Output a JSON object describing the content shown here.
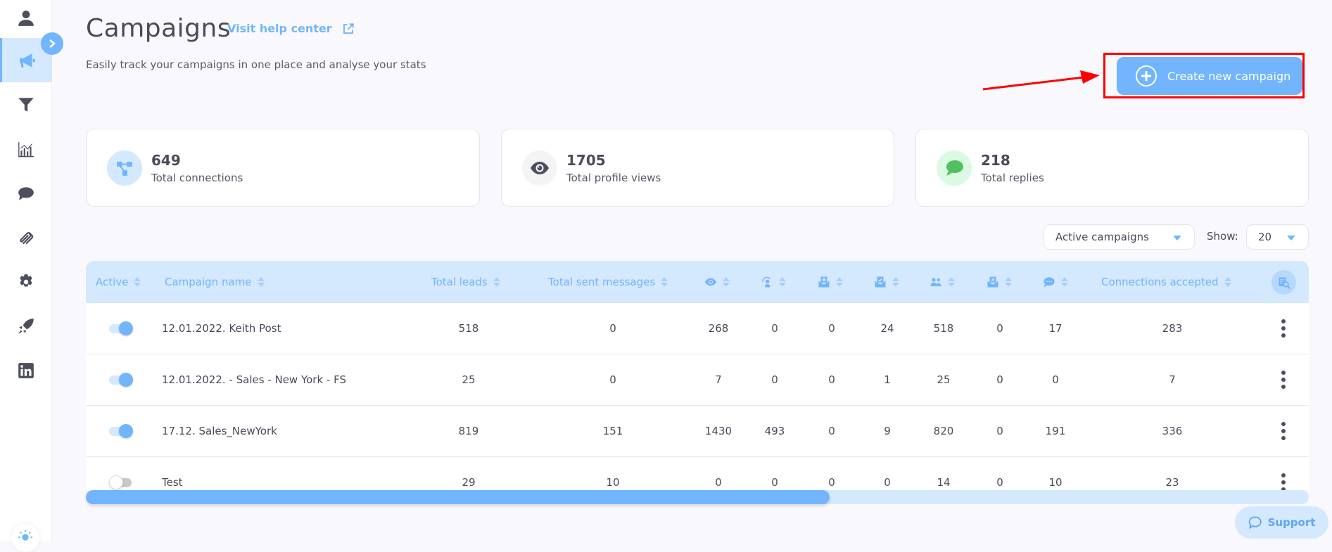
{
  "sidebar": {
    "items": [
      {
        "name": "profile",
        "icon": "user-icon",
        "active": false
      },
      {
        "name": "campaigns",
        "icon": "megaphone-icon",
        "active": true
      },
      {
        "name": "filters",
        "icon": "funnel-icon",
        "active": false
      },
      {
        "name": "analytics",
        "icon": "chart-icon",
        "active": false
      },
      {
        "name": "messages",
        "icon": "chat-bubble-icon",
        "active": false
      },
      {
        "name": "integrations",
        "icon": "paperclip-icon",
        "active": false
      },
      {
        "name": "settings",
        "icon": "gear-icon",
        "active": false
      },
      {
        "name": "launch",
        "icon": "rocket-icon",
        "active": false
      },
      {
        "name": "linkedin",
        "icon": "linkedin-icon",
        "active": false
      }
    ],
    "expand_icon": "chevron-right-icon",
    "theme_icon": "sun-icon"
  },
  "header": {
    "title": "Campaigns",
    "help_link": "Visit help center",
    "subtitle": "Easily track your campaigns in one place and analyse your stats",
    "create_button": "Create new campaign"
  },
  "stats": [
    {
      "value": "649",
      "label": "Total connections",
      "icon": "network-icon",
      "icon_bg": "#d4e8fe",
      "icon_color": "#72b5fd"
    },
    {
      "value": "1705",
      "label": "Total profile views",
      "icon": "eye-icon",
      "icon_bg": "#f4f4f6",
      "icon_color": "#4d4f5c"
    },
    {
      "value": "218",
      "label": "Total replies",
      "icon": "speech-bubble-icon",
      "icon_bg": "#dcfae3",
      "icon_color": "#50c060"
    }
  ],
  "filters": {
    "campaign_filter": "Active campaigns",
    "show_label": "Show:",
    "show_value": "20"
  },
  "table": {
    "columns": [
      {
        "label": "Active"
      },
      {
        "label": "Campaign name"
      },
      {
        "label": "Total leads"
      },
      {
        "label": "Total sent messages"
      },
      {
        "label": "",
        "icon": "eye-icon"
      },
      {
        "label": "",
        "icon": "follow-icon"
      },
      {
        "label": "",
        "icon": "mail-pending-icon"
      },
      {
        "label": "",
        "icon": "mail-accepted-icon"
      },
      {
        "label": "",
        "icon": "people-icon"
      },
      {
        "label": "",
        "icon": "mail-reply-icon"
      },
      {
        "label": "",
        "icon": "chat-icon"
      },
      {
        "label": "Connections accepted"
      }
    ],
    "search_icon": "column-search-icon",
    "rows": [
      {
        "active": true,
        "name": "12.01.2022. Keith Post",
        "values": [
          "518",
          "0",
          "268",
          "0",
          "0",
          "24",
          "518",
          "0",
          "17",
          "283"
        ]
      },
      {
        "active": true,
        "name": "12.01.2022. - Sales - New York - FS",
        "values": [
          "25",
          "0",
          "7",
          "0",
          "0",
          "1",
          "25",
          "0",
          "0",
          "7"
        ]
      },
      {
        "active": true,
        "name": "17.12. Sales_NewYork",
        "values": [
          "819",
          "151",
          "1430",
          "493",
          "0",
          "9",
          "820",
          "0",
          "191",
          "336"
        ]
      },
      {
        "active": false,
        "name": "Test",
        "values": [
          "29",
          "10",
          "0",
          "0",
          "0",
          "0",
          "14",
          "0",
          "10",
          "23"
        ]
      }
    ],
    "scroll_fraction": 0.5
  },
  "support": {
    "label": "Support"
  },
  "colors": {
    "accent": "#72b5fd",
    "accent_light": "#d4e8fe",
    "text": "#4a4a5a",
    "annotation": "#ff0000"
  }
}
